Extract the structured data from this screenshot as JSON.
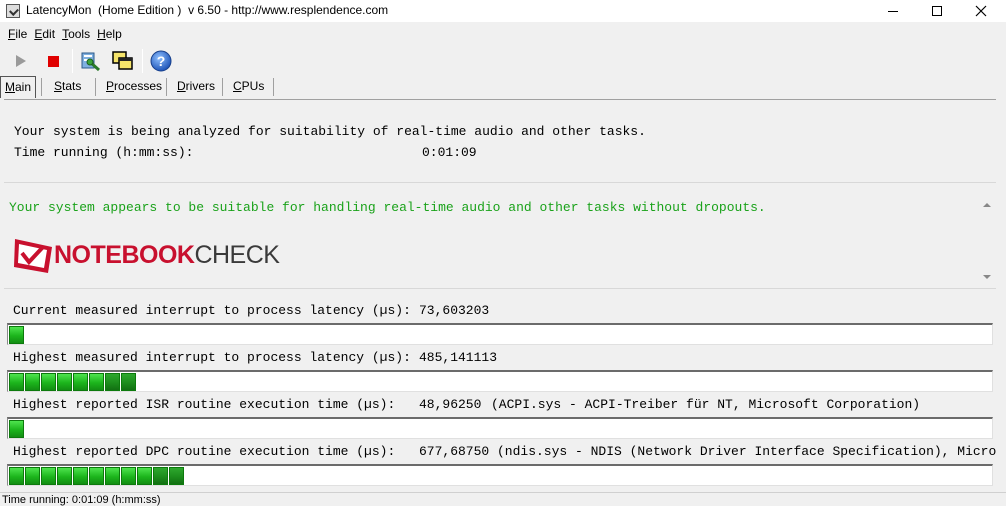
{
  "window": {
    "title": "LatencyMon  (Home Edition )  v 6.50 - http://www.resplendence.com"
  },
  "menu": [
    "File",
    "Edit",
    "Tools",
    "Help"
  ],
  "toolbar": {
    "icons": [
      "play-icon",
      "stop-icon",
      "report-icon",
      "windows-icon",
      "help-icon"
    ],
    "help_glyph": "?"
  },
  "tabs": [
    "Main",
    "Stats",
    "Processes",
    "Drivers",
    "CPUs"
  ],
  "main": {
    "analyzing_text": "Your system is being analyzed for suitability of real-time audio and other tasks.",
    "time_label": "Time running (h:mm:ss):",
    "time_value": "0:01:09",
    "verdict_text": "Your system appears to be suitable for handling real-time audio and other tasks without dropouts.",
    "verdict_color": "#1aa21a",
    "logo_bold": "NOTEBOOK",
    "logo_thin": "CHECK"
  },
  "measurements": [
    {
      "label": "Current measured interrupt to process latency (µs):",
      "value": "73,603203",
      "detail": "",
      "blocks": 1
    },
    {
      "label": "Highest measured interrupt to process latency (µs):",
      "value": "485,141113",
      "detail": "",
      "blocks": 8
    },
    {
      "label": "Highest reported ISR routine execution time (µs):",
      "value": "48,96250",
      "detail": "(ACPI.sys - ACPI-Treiber für NT, Microsoft Corporation)",
      "blocks": 1
    },
    {
      "label": "Highest reported DPC routine execution time (µs):",
      "value": "677,68750",
      "detail": "(ndis.sys - NDIS (Network Driver Interface Specification), Microsoft Co",
      "blocks": 11
    }
  ],
  "status": {
    "text": "Time running: 0:01:09  (h:mm:ss)"
  }
}
